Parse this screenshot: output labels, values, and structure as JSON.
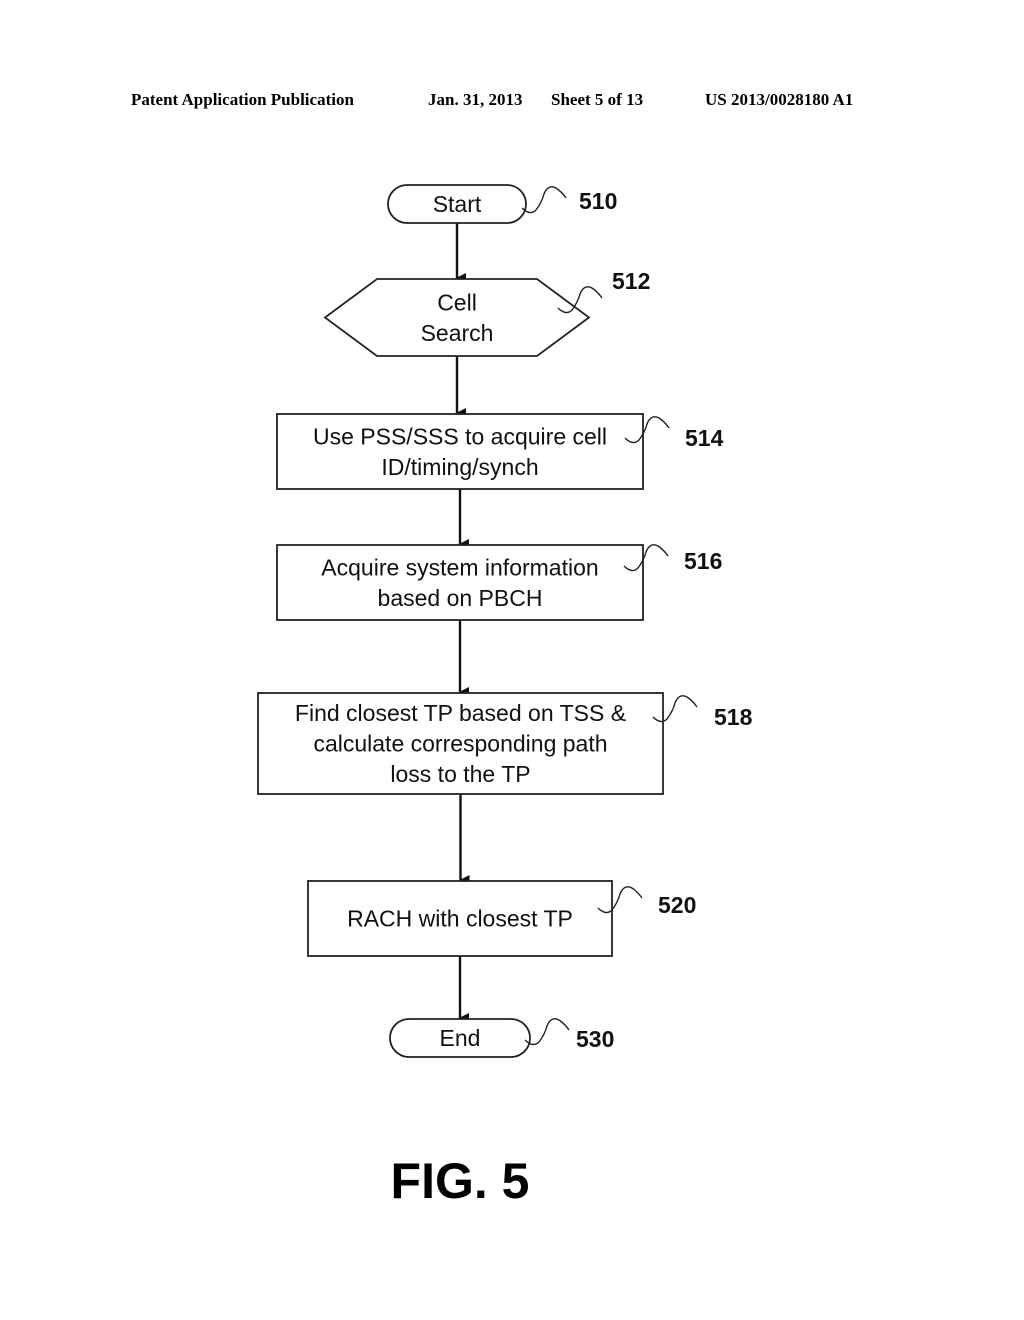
{
  "header": {
    "publication": "Patent Application Publication",
    "date": "Jan. 31, 2013",
    "sheet": "Sheet 5 of 13",
    "number": "US 2013/0028180 A1"
  },
  "figure": {
    "label": "FIG. 5"
  },
  "nodes": [
    {
      "id": "510",
      "type": "terminal",
      "lines": [
        "Start"
      ],
      "ref": "510"
    },
    {
      "id": "512",
      "type": "hexagon",
      "lines": [
        "Cell",
        "Search"
      ],
      "ref": "512"
    },
    {
      "id": "514",
      "type": "process",
      "lines": [
        "Use PSS/SSS to acquire cell",
        "ID/timing/synch"
      ],
      "ref": "514"
    },
    {
      "id": "516",
      "type": "process",
      "lines": [
        "Acquire system information",
        "based on PBCH"
      ],
      "ref": "516"
    },
    {
      "id": "518",
      "type": "process",
      "lines": [
        "Find closest TP based on TSS &",
        "calculate corresponding path",
        "loss to the TP"
      ],
      "ref": "518"
    },
    {
      "id": "520",
      "type": "process",
      "lines": [
        "RACH with closest TP"
      ],
      "ref": "520"
    },
    {
      "id": "530",
      "type": "terminal",
      "lines": [
        "End"
      ],
      "ref": "530"
    }
  ],
  "edges": [
    {
      "from": "510",
      "to": "512"
    },
    {
      "from": "512",
      "to": "514"
    },
    {
      "from": "514",
      "to": "516"
    },
    {
      "from": "516",
      "to": "518"
    },
    {
      "from": "518",
      "to": "520"
    },
    {
      "from": "520",
      "to": "530"
    }
  ]
}
